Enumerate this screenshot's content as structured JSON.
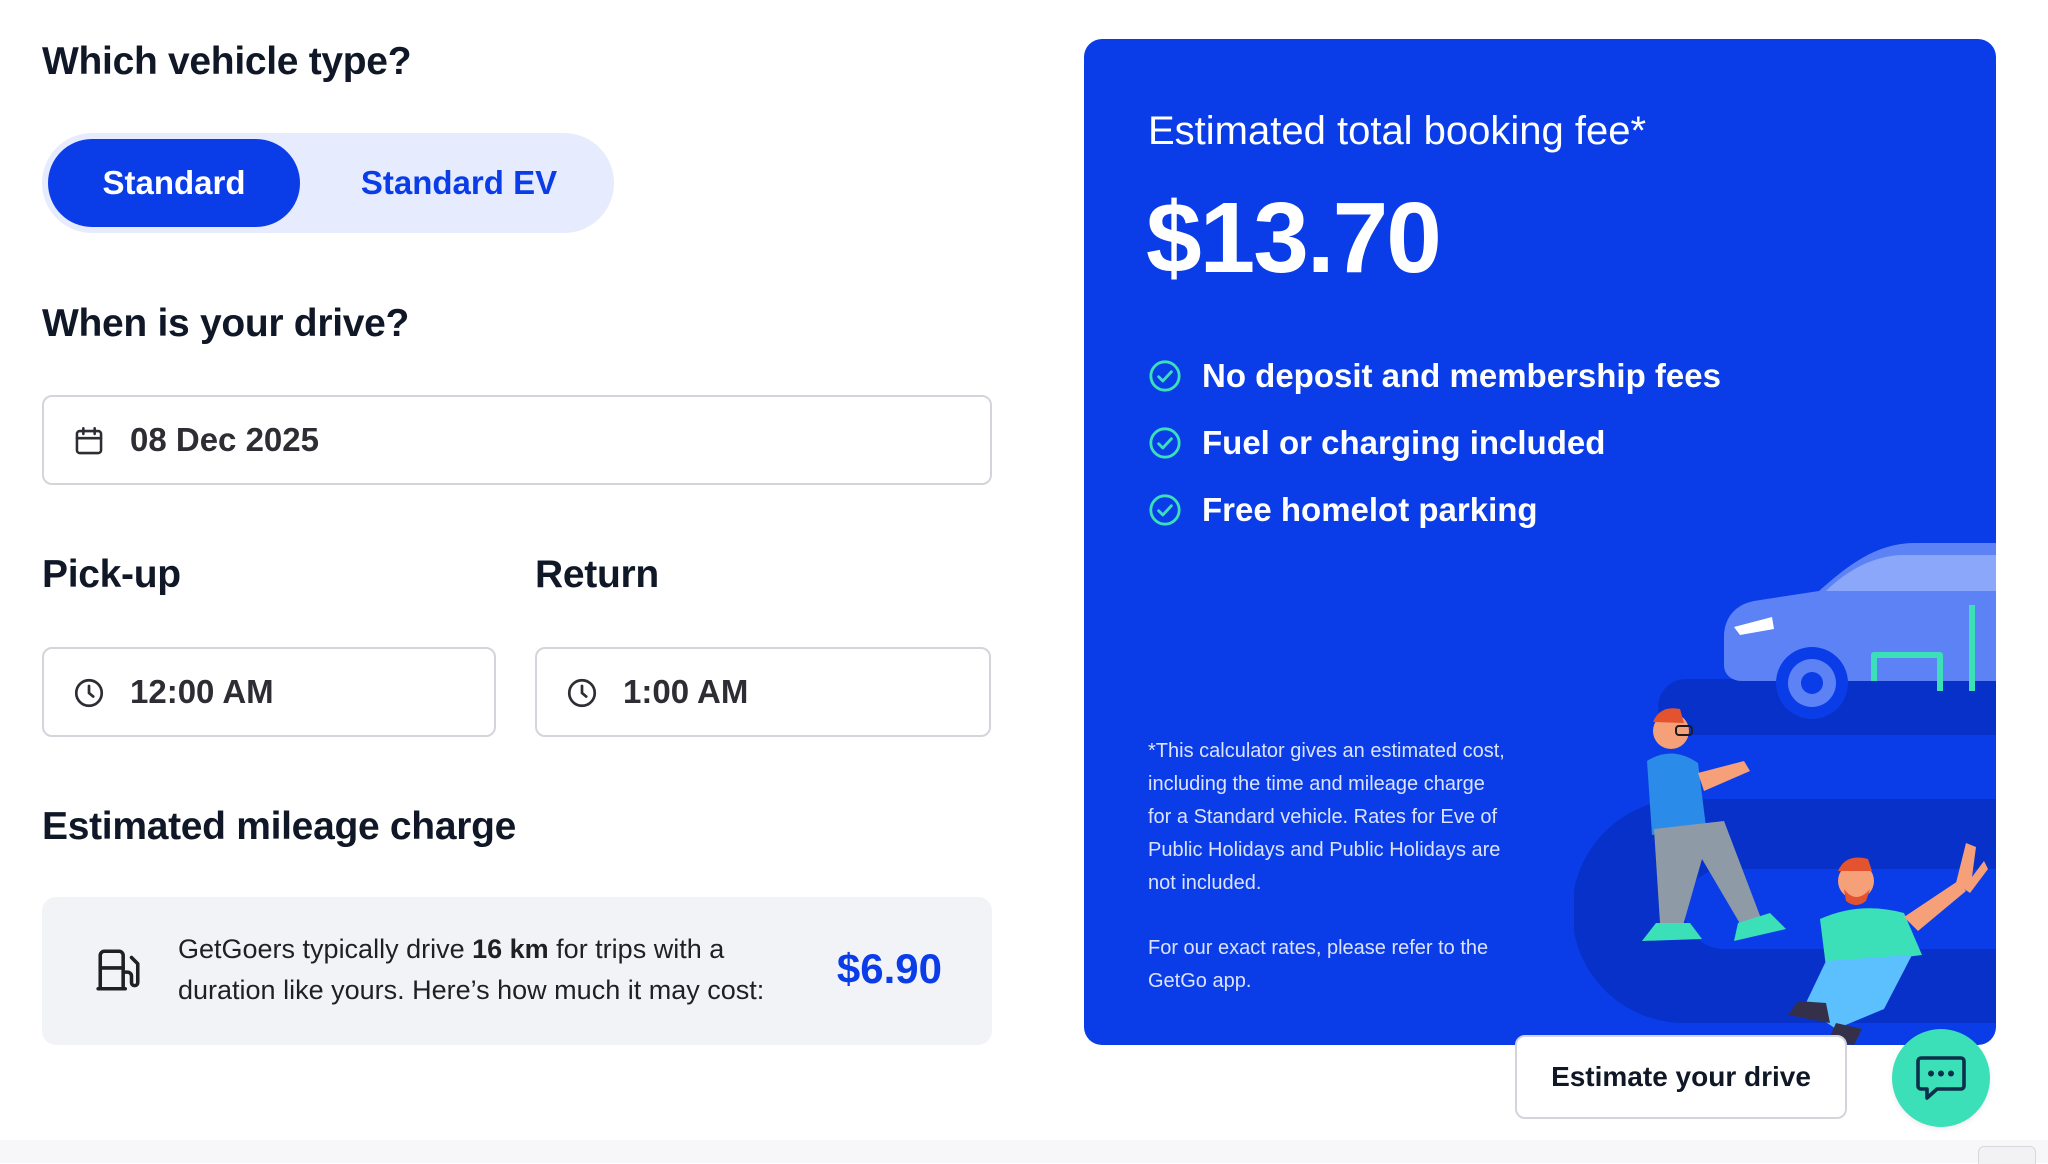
{
  "vehicle": {
    "heading": "Which vehicle type?",
    "options": [
      {
        "label": "Standard",
        "selected": true
      },
      {
        "label": "Standard EV",
        "selected": false
      }
    ]
  },
  "date": {
    "heading": "When is your drive?",
    "value": "08 Dec 2025",
    "icon": "calendar-icon"
  },
  "pickup": {
    "heading": "Pick-up",
    "value": "12:00 AM",
    "icon": "clock-icon"
  },
  "return": {
    "heading": "Return",
    "value": "1:00 AM",
    "icon": "clock-icon"
  },
  "mileage": {
    "heading": "Estimated mileage charge",
    "text_before": "GetGoers typically drive ",
    "distance": "16 km",
    "text_after": " for trips with a duration like yours. Here’s how much it may cost:",
    "price": "$6.90",
    "icon": "fuel-pump-icon"
  },
  "estimate": {
    "label": "Estimated total booking fee*",
    "total": "$13.70",
    "benefits": [
      "No deposit and membership fees",
      "Fuel or charging included",
      "Free homelot parking"
    ],
    "disclaimer": "*This calculator gives an estimated cost, including the time and mileage charge for a Standard vehicle. Rates for Eve of Public Holidays and Public Holidays are not included.",
    "reference": "For our exact rates, please refer to the GetGo app."
  },
  "cta": {
    "estimate_label": "Estimate your drive",
    "chat_icon": "chat-icon"
  },
  "colors": {
    "brand_blue": "#0a3de8",
    "accent_green": "#3be0b8",
    "toggle_bg": "#e6ebfd"
  }
}
